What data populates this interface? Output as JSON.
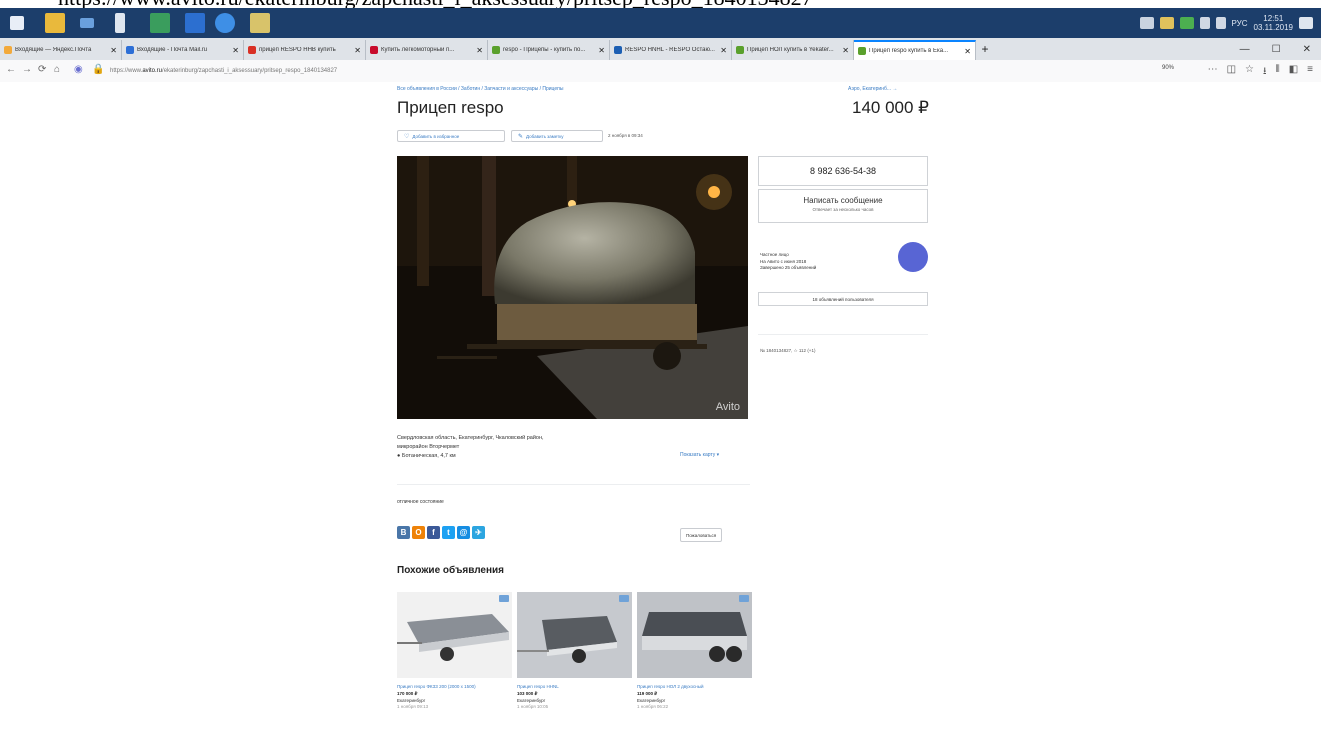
{
  "url_caption": "https://www.avito.ru/ekaterinburg/zapchasti_i_aksessuary/pritsep_respo_1840134827",
  "taskbar": {
    "clock_time": "12:51",
    "clock_date": "03.11.2019",
    "lang": "РУС"
  },
  "tabs": [
    {
      "label": "Входящие — Яндекс.Почта",
      "color": "#f2a93b"
    },
    {
      "label": "Входящие - Почта Mail.ru",
      "color": "#2d6fd6"
    },
    {
      "label": "прицеп RESPO ННВ купить",
      "color": "#d93025"
    },
    {
      "label": "Купить легкомоторный п...",
      "color": "#c80c2c"
    },
    {
      "label": "respo - Прицепы - купить по...",
      "color": "#5aa02c"
    },
    {
      "label": "RESPO НNHL - RESPO Остаю...",
      "color": "#1d5fb3"
    },
    {
      "label": "Прицеп НОЛ купить в Yekater...",
      "color": "#5aa02c"
    },
    {
      "label": "Прицеп respo купить в Ека...",
      "color": "#5aa02c",
      "active": true
    }
  ],
  "navbar": {
    "url_prefix": "https://www.",
    "url_host": "avito.ru",
    "url_rest": "/ekaterinburg/zapchasti_i_aksessuary/pritsep_respo_1840134827",
    "zoom": "90%"
  },
  "listing": {
    "breadcrumbs": "Все объявления в России / Заботин / Запчасти и аксессуары / Прицепы",
    "location_link": "Аэро, Екатеринб... →",
    "title": "Прицеп respo",
    "price": "140 000 ₽",
    "add_favorite": "Добавить в избранное",
    "add_note": "Добавить заметку",
    "date": "2 ноября в 09:34",
    "photo_watermark": "Avito"
  },
  "contact": {
    "phone": "8 982 636-54-38",
    "write_message": "Написать сообщение",
    "reply_note": "Отвечает за несколько часов"
  },
  "seller": {
    "type": "Частное лицо",
    "since": "На Авито с июня 2018",
    "completed": "Завершено 25 объявлений",
    "all_ads": "18 объявлений пользователя"
  },
  "ad_id": "№ 1840134827, ☆ 112 (+1)",
  "address": {
    "line1": "Свердловская область, Екатеринбург, Чкаловский район,",
    "line2": "микрорайон Вторчермет",
    "line3": "● Ботаническая, 4,7 км",
    "map_link": "Показать карту ▾"
  },
  "condition": "отличное состояние",
  "share_icons": [
    {
      "name": "vk",
      "glyph": "В",
      "color": "#4a76a8"
    },
    {
      "name": "ok",
      "glyph": "О",
      "color": "#ee8208"
    },
    {
      "name": "fb",
      "glyph": "f",
      "color": "#3b5998"
    },
    {
      "name": "tw",
      "glyph": "t",
      "color": "#1da1f2"
    },
    {
      "name": "mail",
      "glyph": "@",
      "color": "#168de2"
    },
    {
      "name": "tg",
      "glyph": "✈",
      "color": "#2ca5e0"
    }
  ],
  "complain": "Пожаловаться",
  "similar": {
    "heading": "Похожие объявления",
    "items": [
      {
        "name": "Прицеп respo ФКЗЗ 200 (2000 x 1500)",
        "price": "170 000 ₽",
        "city": "Екатеринбург",
        "when": "1 ноября 09:13"
      },
      {
        "name": "Прицеп respo HHNL",
        "price": "103 000 ₽",
        "city": "Екатеринбург",
        "when": "1 ноября 10:05"
      },
      {
        "name": "Прицеп respo НОЛ 2 двухосный",
        "price": "119 000 ₽",
        "city": "Екатеринбург",
        "when": "1 ноября 06:22"
      }
    ]
  }
}
